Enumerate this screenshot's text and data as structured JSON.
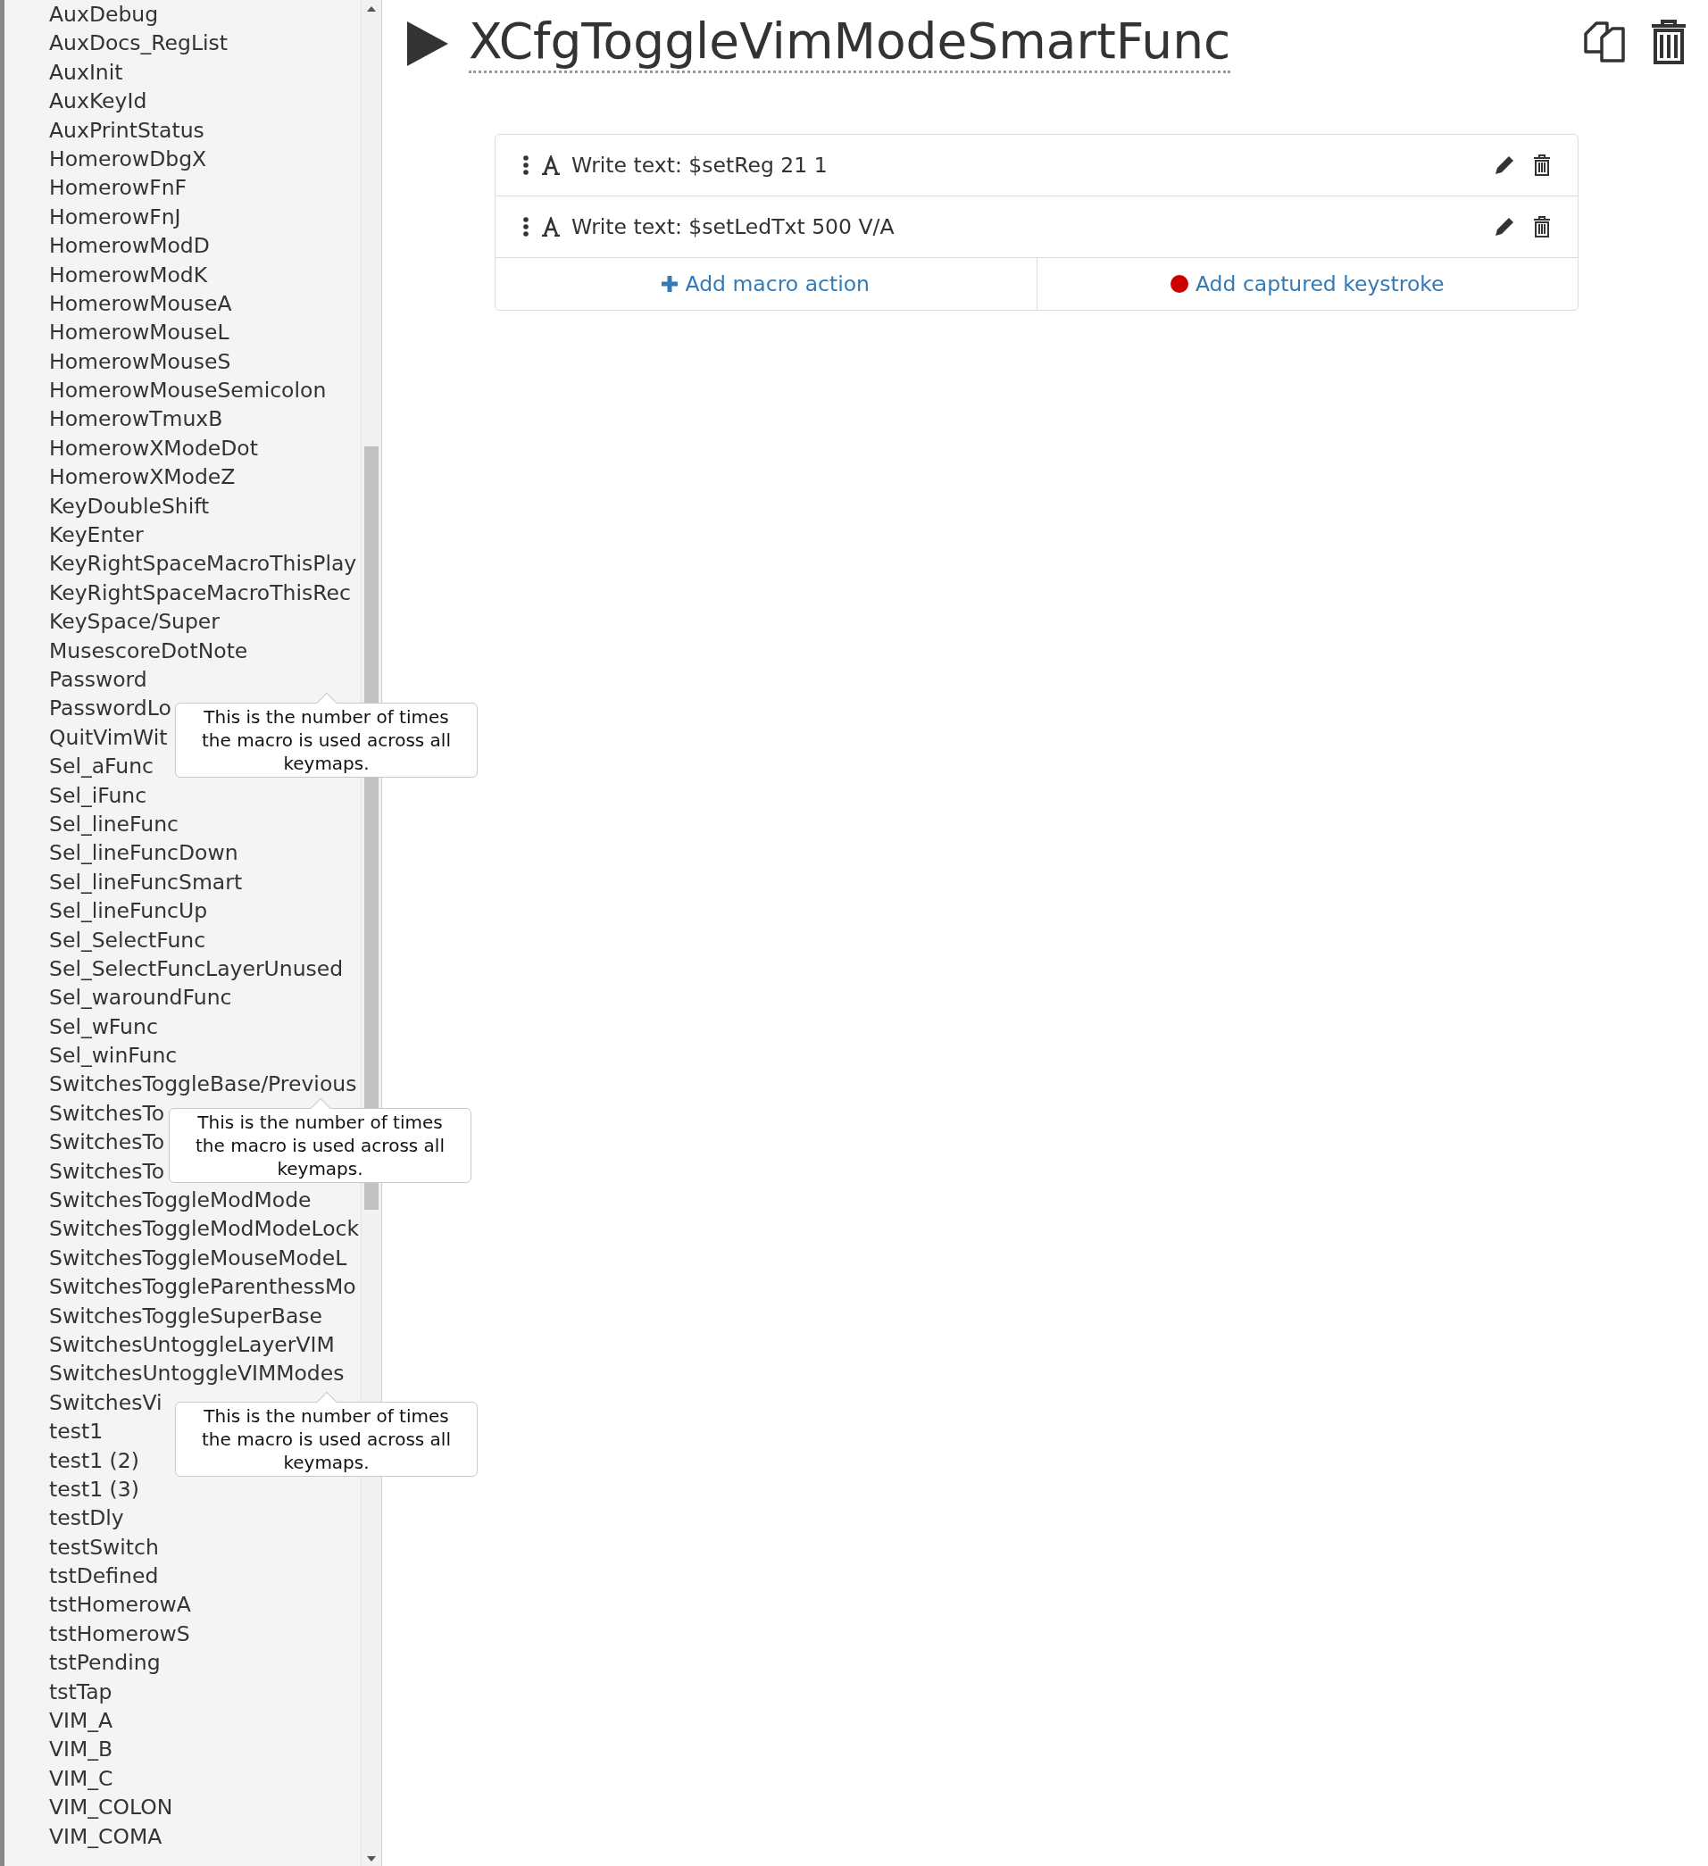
{
  "sidebar": {
    "items": [
      {
        "label": "AuxDebug"
      },
      {
        "label": "AuxDocs_RegList"
      },
      {
        "label": "AuxInit"
      },
      {
        "label": "AuxKeyId"
      },
      {
        "label": "AuxPrintStatus"
      },
      {
        "label": "HomerowDbgX"
      },
      {
        "label": "HomerowFnF"
      },
      {
        "label": "HomerowFnJ"
      },
      {
        "label": "HomerowModD"
      },
      {
        "label": "HomerowModK"
      },
      {
        "label": "HomerowMouseA"
      },
      {
        "label": "HomerowMouseL"
      },
      {
        "label": "HomerowMouseS"
      },
      {
        "label": "HomerowMouseSemicolon"
      },
      {
        "label": "HomerowTmuxB"
      },
      {
        "label": "HomerowXModeDot"
      },
      {
        "label": "HomerowXModeZ"
      },
      {
        "label": "KeyDoubleShift"
      },
      {
        "label": "KeyEnter"
      },
      {
        "label": "KeyRightSpaceMacroThisPlay"
      },
      {
        "label": "KeyRightSpaceMacroThisRec"
      },
      {
        "label": "KeySpace/Super"
      },
      {
        "label": "MusescoreDotNote"
      },
      {
        "label": "Password"
      },
      {
        "label": "PasswordLo"
      },
      {
        "label": "QuitVimWit"
      },
      {
        "label": "Sel_aFunc"
      },
      {
        "label": "Sel_iFunc"
      },
      {
        "label": "Sel_lineFunc"
      },
      {
        "label": "Sel_lineFuncDown"
      },
      {
        "label": "Sel_lineFuncSmart"
      },
      {
        "label": "Sel_lineFuncUp"
      },
      {
        "label": "Sel_SelectFunc"
      },
      {
        "label": "Sel_SelectFuncLayerUnused"
      },
      {
        "label": "Sel_waroundFunc"
      },
      {
        "label": "Sel_wFunc"
      },
      {
        "label": "Sel_winFunc"
      },
      {
        "label": "SwitchesToggleBase/Previous"
      },
      {
        "label": "SwitchesTo"
      },
      {
        "label": "SwitchesTo"
      },
      {
        "label": "SwitchesTo"
      },
      {
        "label": "SwitchesToggleModMode"
      },
      {
        "label": "SwitchesToggleModModeLock"
      },
      {
        "label": "SwitchesToggleMouseModeL"
      },
      {
        "label": "SwitchesToggleParenthessMo"
      },
      {
        "label": "SwitchesToggleSuperBase"
      },
      {
        "label": "SwitchesUntoggleLayerVIM"
      },
      {
        "label": "SwitchesUntoggleVIMModes"
      },
      {
        "label": "SwitchesVi"
      },
      {
        "label": "test1"
      },
      {
        "label": "test1 (2)"
      },
      {
        "label": "test1 (3)"
      },
      {
        "label": "testDly"
      },
      {
        "label": "testSwitch"
      },
      {
        "label": "tstDefined"
      },
      {
        "label": "tstHomerowA"
      },
      {
        "label": "tstHomerowS"
      },
      {
        "label": "tstPending"
      },
      {
        "label": "tstTap"
      },
      {
        "label": "VIM_A"
      },
      {
        "label": "VIM_B"
      },
      {
        "label": "VIM_C"
      },
      {
        "label": "VIM_COLON"
      },
      {
        "label": "VIM_COMA"
      }
    ]
  },
  "tooltips": [
    {
      "text": "This is the number of times the macro is used across all keymaps."
    },
    {
      "text": "This is the number of times the macro is used across all keymaps."
    },
    {
      "text": "This is the number of times the macro is used across all keymaps."
    }
  ],
  "macro": {
    "title": "XCfgToggleVimModeSmartFunc",
    "actions": [
      {
        "text": "Write text: $setReg 21 1"
      },
      {
        "text": "Write text: $setLedTxt 500 V/A"
      }
    ],
    "buttons": [
      {
        "kind": "add",
        "label": "Add macro action"
      },
      {
        "kind": "record",
        "label": "Add captured keystroke"
      }
    ]
  }
}
